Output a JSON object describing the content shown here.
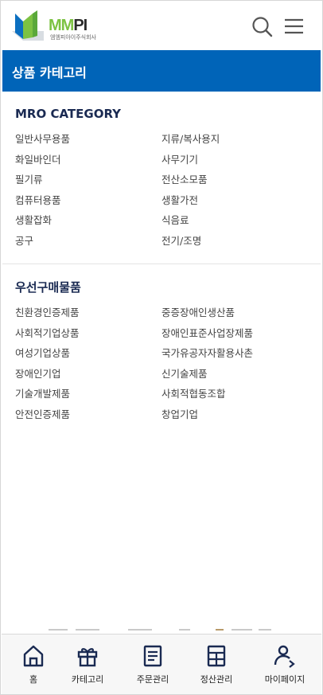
{
  "header": {
    "logo_text": "MMPI",
    "logo_sub": "엠엠피아이주식회사",
    "search_icon": "search-icon",
    "menu_icon": "hamburger-menu-icon"
  },
  "page_title": "상품 카테고리",
  "mro": {
    "title": "MRO CATEGORY",
    "items": [
      "일반사무용품",
      "지류/복사용지",
      "화일바인더",
      "사무기기",
      "필기류",
      "전산소모품",
      "컴퓨터용품",
      "생활가전",
      "생활잡화",
      "식음료",
      "공구",
      "전기/조명"
    ]
  },
  "priority": {
    "title": "우선구매물품",
    "items": [
      "친환경인증제품",
      "중증장애인생산품",
      "사회적기업상품",
      "장애인표준사업장제품",
      "여성기업상품",
      "국가유공자자활용사촌",
      "장애인기업",
      "신기술제품",
      "기술개발제품",
      "사회적협동조합",
      "안전인증제품",
      "창업기업"
    ]
  },
  "bottom_nav": {
    "home": "홈",
    "category": "카테고리",
    "orders": "주문관리",
    "settlement": "정산관리",
    "mypage": "마이페이지"
  },
  "colors": {
    "brand_blue": "#0064b8",
    "section_title": "#1a2a52",
    "nav_icon": "#1a2a52",
    "logo_green": "#7cc242"
  }
}
